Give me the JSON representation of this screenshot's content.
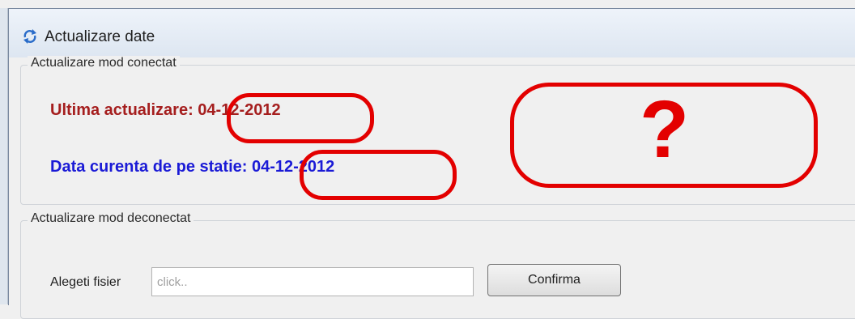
{
  "window": {
    "title": "Actualizare date",
    "icon": "refresh-icon"
  },
  "connected_group": {
    "legend": "Actualizare mod conectat",
    "last_update_text": "Ultima actualizare: 04-12-2012",
    "current_date_text": "Data curenta de pe statie: 04-12-2012",
    "annotation_mark": "?"
  },
  "disconnected_group": {
    "legend": "Actualizare mod deconectat",
    "file_label": "Alegeti fisier",
    "file_placeholder": "click..",
    "confirm_label": "Confirma"
  },
  "colors": {
    "last_update": "#a51e1e",
    "current_date": "#1a1ad6",
    "annotation": "#e30000"
  }
}
